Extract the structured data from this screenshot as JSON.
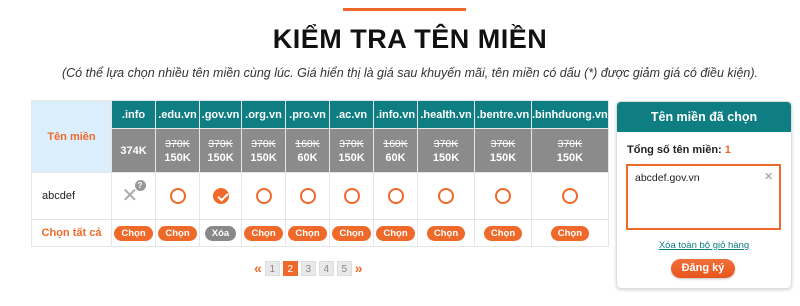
{
  "header": {
    "title": "KIỂM TRA TÊN MIỀN",
    "subtitle": "(Có thể lựa chọn nhiều tên miền cùng lúc. Giá hiển thị là giá sau khuyến mãi, tên miền có dấu (*) được giảm giá có điều kiện)."
  },
  "table": {
    "first_col_header": "Tên miền",
    "columns": [
      {
        "ext": ".info",
        "old_price": "",
        "price": "374K"
      },
      {
        "ext": ".edu.vn",
        "old_price": "370K",
        "price": "150K"
      },
      {
        "ext": ".gov.vn",
        "old_price": "370K",
        "price": "150K"
      },
      {
        "ext": ".org.vn",
        "old_price": "370K",
        "price": "150K"
      },
      {
        "ext": ".pro.vn",
        "old_price": "160K",
        "price": "60K"
      },
      {
        "ext": ".ac.vn",
        "old_price": "370K",
        "price": "150K"
      },
      {
        "ext": ".info.vn",
        "old_price": "160K",
        "price": "60K"
      },
      {
        "ext": ".health.vn",
        "old_price": "370K",
        "price": "150K"
      },
      {
        "ext": ".bentre.vn",
        "old_price": "370K",
        "price": "150K"
      },
      {
        "ext": ".binhduong.vn",
        "old_price": "370K",
        "price": "150K"
      }
    ],
    "row": {
      "domain": "abcdef",
      "states": [
        "unavailable",
        "empty",
        "checked",
        "empty",
        "empty",
        "empty",
        "empty",
        "empty",
        "empty",
        "empty"
      ]
    },
    "select_all_label": "Chọn tất cả",
    "select_buttons": [
      "Chọn",
      "Chọn",
      "Xóa",
      "Chọn",
      "Chọn",
      "Chọn",
      "Chọn",
      "Chọn",
      "Chọn",
      "Chọn"
    ]
  },
  "pager": {
    "prev": "«",
    "next": "»",
    "pages": [
      "1",
      "2",
      "3",
      "4",
      "5"
    ],
    "active": "2"
  },
  "cart": {
    "title": "Tên miền đã chọn",
    "count_label": "Tổng số tên miền:",
    "count": "1",
    "items": [
      "abcdef.gov.vn"
    ],
    "remove_icon": "×",
    "clear_link": "Xóa toàn bộ giỏ hàng",
    "register_button": "Đăng ký"
  },
  "colors": {
    "accent": "#ef6a2a",
    "teal": "#0f7e82",
    "price_bg": "#8b8b8b",
    "label_bg": "#dbeefc"
  }
}
